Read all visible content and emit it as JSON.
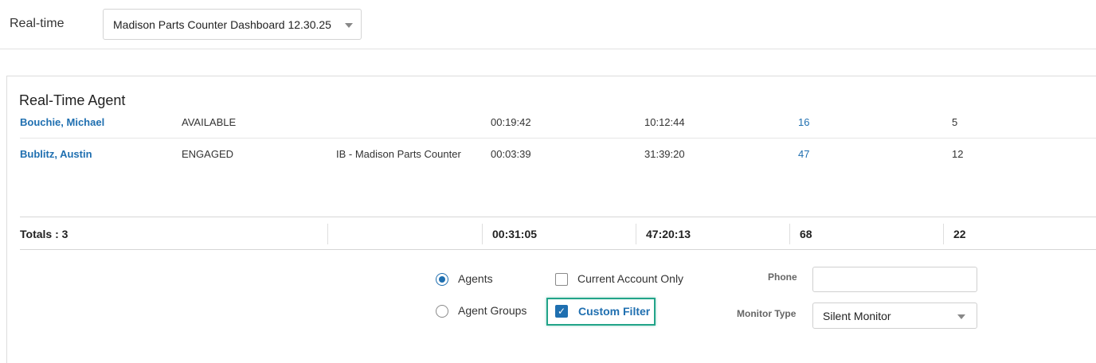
{
  "header": {
    "title": "Real-time",
    "dashboard_select": {
      "value": "Madison Parts Counter Dashboard 12.30.25",
      "icon": "chevron-down-icon"
    }
  },
  "panel": {
    "title": "Real-Time Agent",
    "rows": [
      {
        "name": "Bouchie, Michael",
        "state": "AVAILABLE",
        "queue": "",
        "state_time": "00:19:42",
        "login_time": "10:12:44",
        "calls": "16",
        "other": "5"
      },
      {
        "name": "Bublitz, Austin",
        "state": "ENGAGED",
        "queue": "IB - Madison Parts Counter",
        "state_time": "00:03:39",
        "login_time": "31:39:20",
        "calls": "47",
        "other": "12"
      }
    ],
    "totals": {
      "label": "Totals : 3",
      "state_time": "00:31:05",
      "login_time": "47:20:13",
      "calls": "68",
      "other": "22"
    }
  },
  "controls": {
    "view_mode": {
      "agents_label": "Agents",
      "agent_groups_label": "Agent Groups",
      "selected": "Agents"
    },
    "current_account_only": {
      "label": "Current Account Only",
      "checked": false
    },
    "custom_filter": {
      "label": "Custom Filter",
      "checked": true
    },
    "phone": {
      "label": "Phone",
      "value": "",
      "placeholder": ""
    },
    "monitor_type": {
      "label": "Monitor Type",
      "value": "Silent Monitor"
    }
  },
  "colors": {
    "accent": "#1f6fb0",
    "highlight": "#22a489"
  }
}
